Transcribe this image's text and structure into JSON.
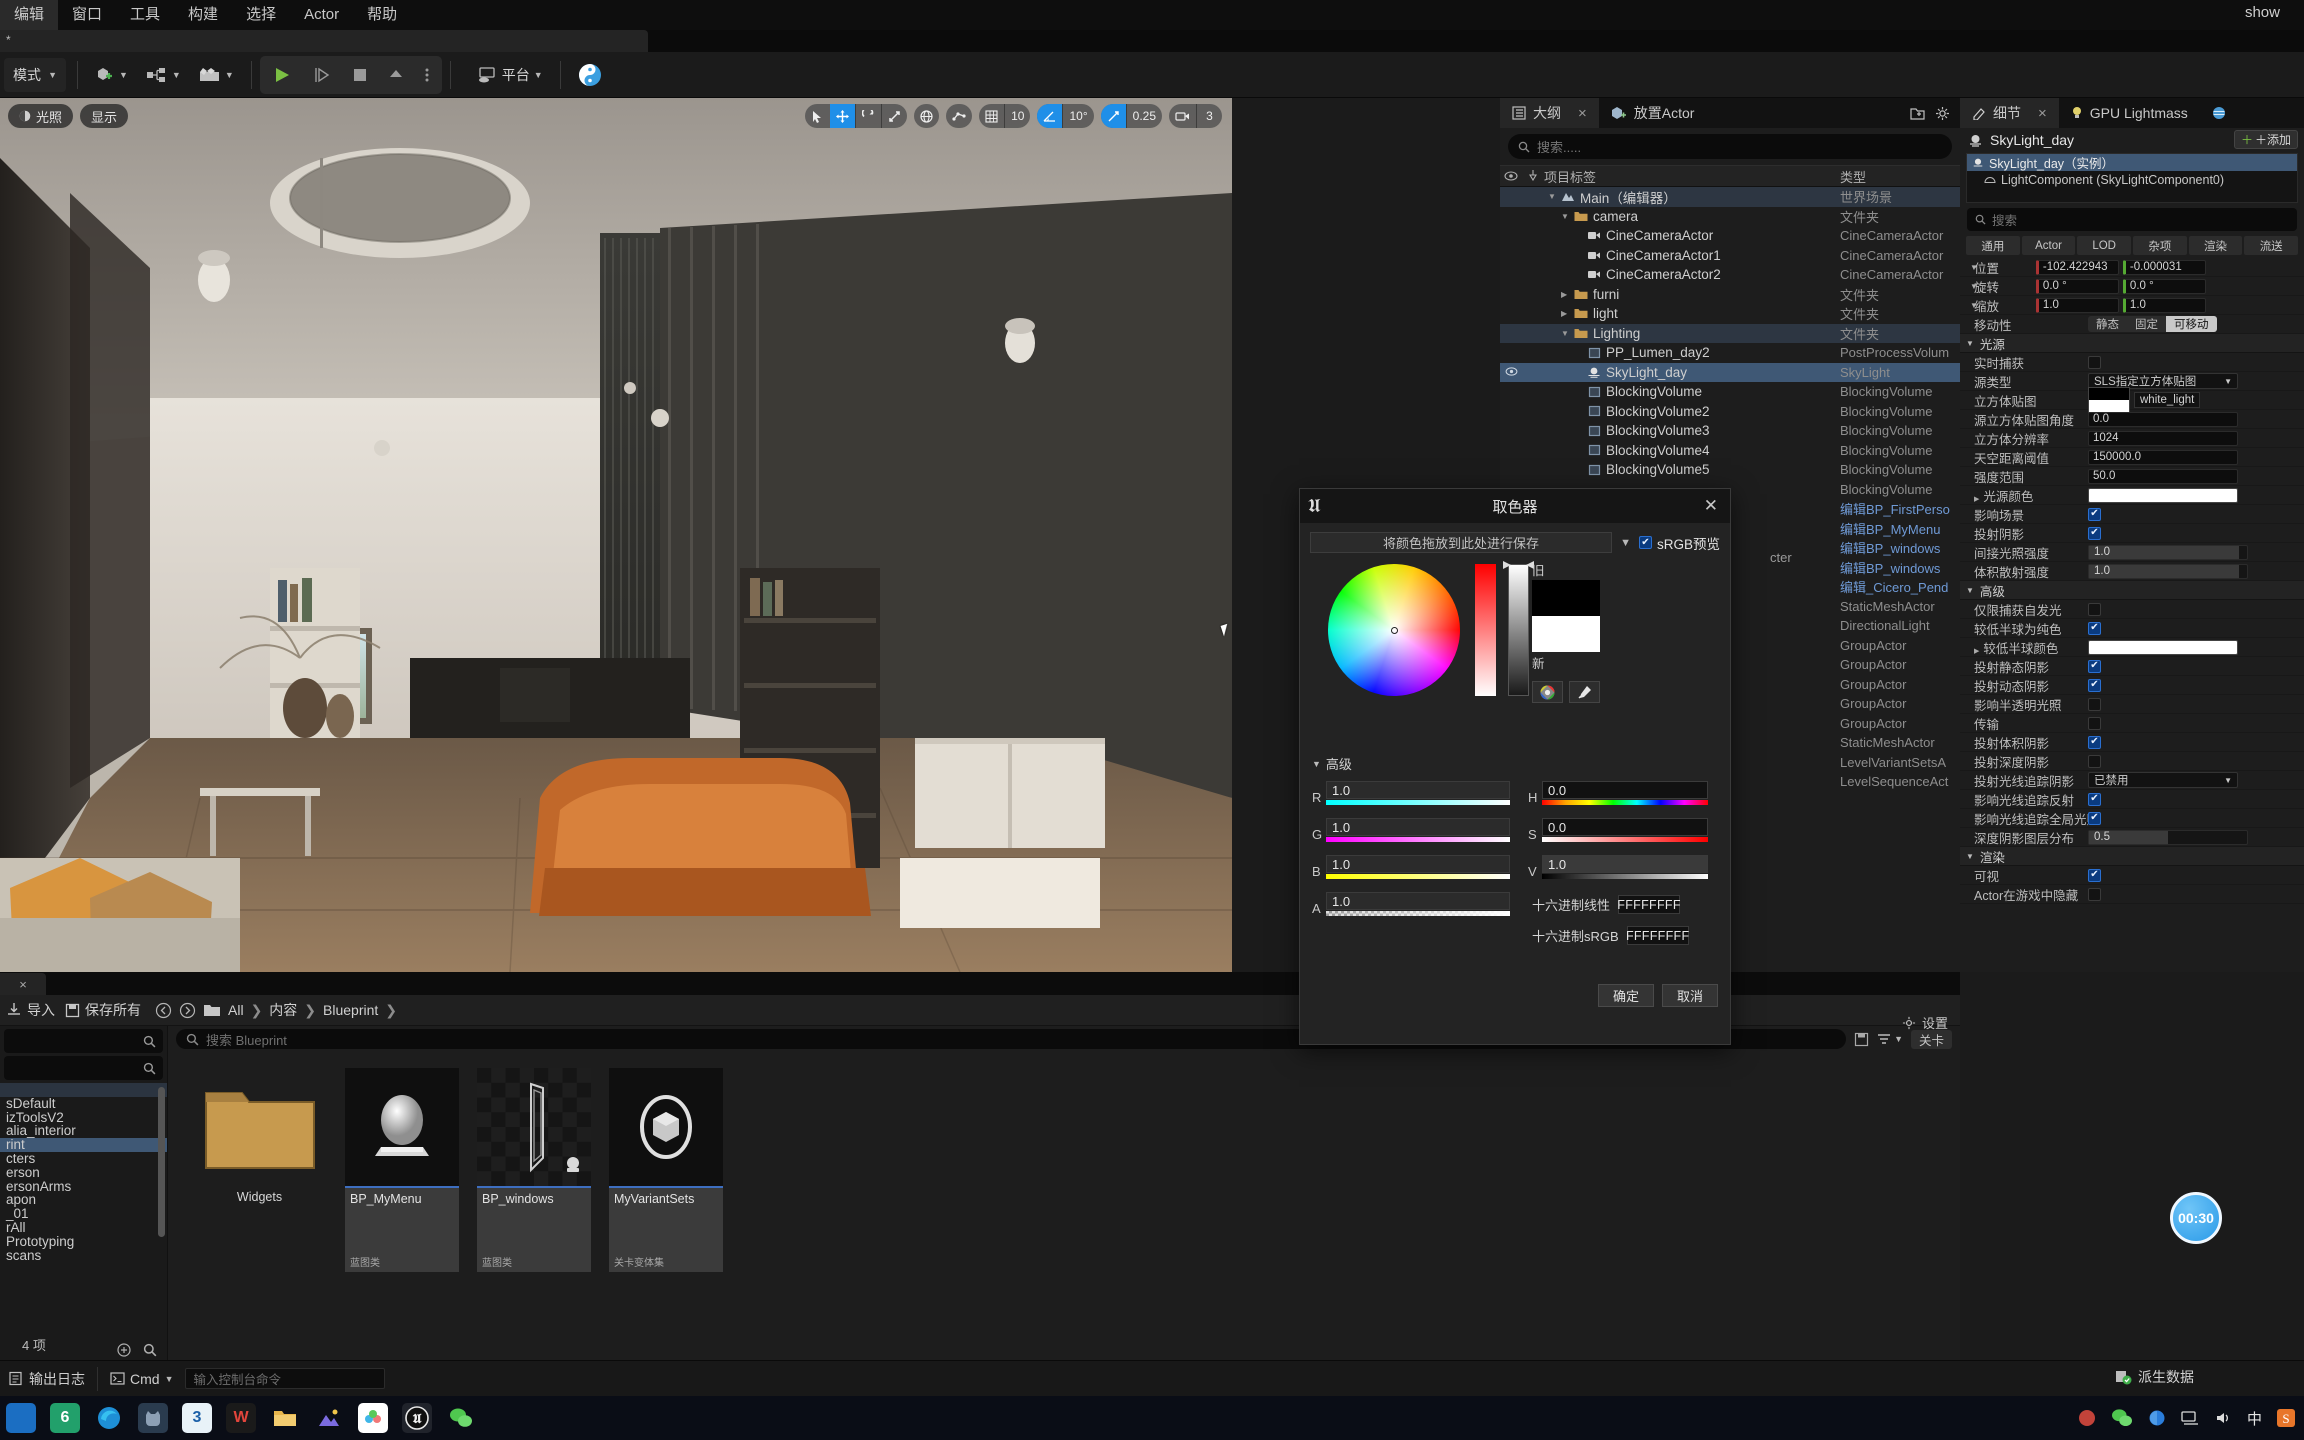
{
  "menubar": {
    "items": [
      "编辑",
      "窗口",
      "工具",
      "构建",
      "选择",
      "Actor",
      "帮助"
    ],
    "right_label": "show"
  },
  "tabstrip": {
    "star": "*"
  },
  "toolbar": {
    "mode_label": "模式",
    "add_label": "",
    "blueprint_label": "",
    "sequence_label": "",
    "platform_label": "平台"
  },
  "viewport": {
    "lighting_pill": "光照",
    "show_pill": "显示",
    "grid_value": "10",
    "angle_value": "10°",
    "scale_value": "0.25",
    "camera_value": "3"
  },
  "outliner": {
    "tab_label": "大纲",
    "tab2_label": "放置Actor",
    "search_placeholder": "搜索.....",
    "col_name": "项目标签",
    "col_type": "类型",
    "rows": [
      {
        "indent": 2,
        "label": "Main（编辑器）",
        "type": "世界场景",
        "state": "softsel",
        "expand": "down",
        "icon": "world-icon",
        "eye": false
      },
      {
        "indent": 3,
        "label": "camera",
        "type": "文件夹",
        "state": "",
        "expand": "down",
        "icon": "folder-icon",
        "eye": false
      },
      {
        "indent": 4,
        "label": "CineCameraActor",
        "type": "CineCameraActor",
        "state": "",
        "expand": "",
        "icon": "camera-icon",
        "eye": false
      },
      {
        "indent": 4,
        "label": "CineCameraActor1",
        "type": "CineCameraActor",
        "state": "",
        "expand": "",
        "icon": "camera-icon",
        "eye": false
      },
      {
        "indent": 4,
        "label": "CineCameraActor2",
        "type": "CineCameraActor",
        "state": "",
        "expand": "",
        "icon": "camera-icon",
        "eye": false
      },
      {
        "indent": 3,
        "label": "furni",
        "type": "文件夹",
        "state": "",
        "expand": "right",
        "icon": "folder-icon",
        "eye": false
      },
      {
        "indent": 3,
        "label": "light",
        "type": "文件夹",
        "state": "",
        "expand": "right",
        "icon": "folder-icon",
        "eye": false
      },
      {
        "indent": 3,
        "label": "Lighting",
        "type": "文件夹",
        "state": "softsel",
        "expand": "down",
        "icon": "folder-icon",
        "eye": false
      },
      {
        "indent": 4,
        "label": "PP_Lumen_day2",
        "type": "PostProcessVolum",
        "state": "",
        "expand": "",
        "icon": "volume-icon",
        "eye": false
      },
      {
        "indent": 4,
        "label": "SkyLight_day",
        "type": "SkyLight",
        "state": "sel",
        "expand": "",
        "icon": "skylight-icon",
        "eye": true
      },
      {
        "indent": 4,
        "label": "BlockingVolume",
        "type": "BlockingVolume",
        "state": "",
        "expand": "",
        "icon": "volume-icon",
        "eye": false
      },
      {
        "indent": 4,
        "label": "BlockingVolume2",
        "type": "BlockingVolume",
        "state": "",
        "expand": "",
        "icon": "volume-icon",
        "eye": false
      },
      {
        "indent": 4,
        "label": "BlockingVolume3",
        "type": "BlockingVolume",
        "state": "",
        "expand": "",
        "icon": "volume-icon",
        "eye": false
      },
      {
        "indent": 4,
        "label": "BlockingVolume4",
        "type": "BlockingVolume",
        "state": "",
        "expand": "",
        "icon": "volume-icon",
        "eye": false
      },
      {
        "indent": 4,
        "label": "BlockingVolume5",
        "type": "BlockingVolume",
        "state": "",
        "expand": "",
        "icon": "volume-icon",
        "eye": false
      },
      {
        "indent": 4,
        "label": "",
        "type": "BlockingVolume",
        "state": "",
        "expand": "",
        "icon": "",
        "eye": false
      },
      {
        "indent": 4,
        "label": "",
        "type": "编辑BP_FirstPerso",
        "type_blue": true,
        "state": "",
        "expand": "",
        "icon": "",
        "eye": false
      },
      {
        "indent": 4,
        "label": "",
        "type": "编辑BP_MyMenu",
        "type_blue": true,
        "state": "",
        "expand": "",
        "icon": "",
        "eye": false
      },
      {
        "indent": 4,
        "label": "",
        "type": "编辑BP_windows",
        "type_blue": true,
        "state": "",
        "expand": "",
        "icon": "",
        "eye": false
      },
      {
        "indent": 4,
        "label": "",
        "type": "编辑BP_windows",
        "type_blue": true,
        "state": "",
        "expand": "",
        "icon": "",
        "eye": false
      },
      {
        "indent": 4,
        "label": "",
        "type": "编辑_Cicero_Pend",
        "type_blue": true,
        "state": "",
        "expand": "",
        "icon": "",
        "eye": false
      },
      {
        "indent": 4,
        "label": "",
        "type": "StaticMeshActor",
        "state": "",
        "expand": "",
        "icon": "",
        "eye": false
      },
      {
        "indent": 4,
        "label": "",
        "type": "DirectionalLight",
        "state": "",
        "expand": "",
        "icon": "",
        "eye": false
      },
      {
        "indent": 4,
        "label": "",
        "type": "GroupActor",
        "state": "",
        "expand": "",
        "icon": "",
        "eye": false
      },
      {
        "indent": 4,
        "label": "",
        "type": "GroupActor",
        "state": "",
        "expand": "",
        "icon": "",
        "eye": false
      },
      {
        "indent": 4,
        "label": "",
        "type": "GroupActor",
        "state": "",
        "expand": "",
        "icon": "",
        "eye": false
      },
      {
        "indent": 4,
        "label": "",
        "type": "GroupActor",
        "state": "",
        "expand": "",
        "icon": "",
        "eye": false
      },
      {
        "indent": 4,
        "label": "",
        "type": "GroupActor",
        "state": "",
        "expand": "",
        "icon": "",
        "eye": false
      },
      {
        "indent": 4,
        "label": "",
        "type": "StaticMeshActor",
        "state": "",
        "expand": "",
        "icon": "",
        "eye": false
      },
      {
        "indent": 4,
        "label": "",
        "type": "LevelVariantSetsA",
        "state": "",
        "expand": "",
        "icon": "",
        "eye": false
      },
      {
        "indent": 4,
        "label": "",
        "type": "LevelSequenceAct",
        "state": "",
        "expand": "",
        "icon": "",
        "eye": false
      }
    ],
    "float_label": "cter"
  },
  "details": {
    "tab_label": "细节",
    "tab2_label": "GPU Lightmass",
    "actor_name": "SkyLight_day",
    "add_button": "＋添加",
    "tree": [
      {
        "label": "SkyLight_day（实例）",
        "selected": true,
        "icon": "skylight-icon"
      },
      {
        "label": "LightComponent (SkyLightComponent0)",
        "selected": false,
        "icon": "component-icon"
      }
    ],
    "search_placeholder": "搜索",
    "categories": [
      "通用",
      "Actor",
      "LOD",
      "杂项",
      "渲染",
      "流送"
    ],
    "transform": [
      {
        "label": "位置",
        "x": "-102.422943",
        "y": "-0.000031",
        "z": ""
      },
      {
        "label": "旋转",
        "x": "0.0 °",
        "y": "0.0 °",
        "z": ""
      },
      {
        "label": "缩放",
        "x": "1.0",
        "y": "1.0",
        "z": ""
      }
    ],
    "mobility_label": "移动性",
    "mobility_options": [
      "静态",
      "固定",
      "可移动"
    ],
    "mobility_selected": "可移动",
    "light_section": "光源",
    "props": [
      {
        "label": "实时捕获",
        "kind": "checkbox",
        "value": false
      },
      {
        "label": "源类型",
        "kind": "dropdown",
        "value": "SLS指定立方体贴图"
      },
      {
        "label": "立方体贴图",
        "kind": "asset",
        "value": "white_light"
      },
      {
        "label": "源立方体贴图角度",
        "kind": "text",
        "value": "0.0"
      },
      {
        "label": "立方体分辨率",
        "kind": "text",
        "value": "1024"
      },
      {
        "label": "天空距离阈值",
        "kind": "text",
        "value": "150000.0"
      },
      {
        "label": "强度范围",
        "kind": "text",
        "value": "50.0"
      },
      {
        "label": "光源颜色",
        "kind": "color",
        "value": "#ffffff",
        "expandable": true
      },
      {
        "label": "影响场景",
        "kind": "checkbox",
        "value": true
      },
      {
        "label": "投射阴影",
        "kind": "checkbox",
        "value": true
      },
      {
        "label": "间接光照强度",
        "kind": "slider",
        "value": "1.0"
      },
      {
        "label": "体积散射强度",
        "kind": "slider",
        "value": "1.0"
      }
    ],
    "advanced_section": "高级",
    "advanced_props": [
      {
        "label": "仅限捕获自发光",
        "kind": "checkbox",
        "value": false
      },
      {
        "label": "较低半球为纯色",
        "kind": "checkbox",
        "value": true
      },
      {
        "label": "较低半球颜色",
        "kind": "color",
        "value": "#ffffff",
        "expandable": true
      },
      {
        "label": "投射静态阴影",
        "kind": "checkbox",
        "value": true
      },
      {
        "label": "投射动态阴影",
        "kind": "checkbox",
        "value": true
      },
      {
        "label": "影响半透明光照",
        "kind": "checkbox",
        "value": false
      },
      {
        "label": "传输",
        "kind": "checkbox",
        "value": false
      },
      {
        "label": "投射体积阴影",
        "kind": "checkbox",
        "value": true
      },
      {
        "label": "投射深度阴影",
        "kind": "checkbox",
        "value": false
      },
      {
        "label": "投射光线追踪阴影",
        "kind": "dropdown",
        "value": "已禁用"
      },
      {
        "label": "影响光线追踪反射",
        "kind": "checkbox",
        "value": true
      },
      {
        "label": "影响光线追踪全局光照",
        "kind": "checkbox",
        "value": true
      },
      {
        "label": "深度阴影图层分布",
        "kind": "slider",
        "value": "0.5"
      }
    ],
    "render_section": "渲染",
    "render_props": [
      {
        "label": "可视",
        "kind": "checkbox",
        "value": true
      },
      {
        "label": "Actor在游戏中隐藏",
        "kind": "checkbox",
        "value": false
      }
    ]
  },
  "content_browser": {
    "tab_close": "×",
    "import_label": "导入",
    "save_all_label": "保存所有",
    "breadcrumb": [
      "All",
      "内容",
      "Blueprint"
    ],
    "search_placeholder": "搜索 Blueprint",
    "filter_label": "关卡",
    "settings_label": "设置",
    "tree_items": [
      {
        "label": "",
        "state": "hl"
      },
      {
        "label": "sDefault",
        "state": ""
      },
      {
        "label": "izToolsV2",
        "state": ""
      },
      {
        "label": "alia_interior",
        "state": ""
      },
      {
        "label": "rint",
        "state": "sel"
      },
      {
        "label": "cters",
        "state": ""
      },
      {
        "label": "erson",
        "state": ""
      },
      {
        "label": "ersonArms",
        "state": ""
      },
      {
        "label": "apon",
        "state": ""
      },
      {
        "label": "_01",
        "state": ""
      },
      {
        "label": "rAll",
        "state": ""
      },
      {
        "label": "Prototyping",
        "state": ""
      },
      {
        "label": "scans",
        "state": ""
      }
    ],
    "tiles": [
      {
        "name": "Widgets",
        "type": "",
        "kind": "folder"
      },
      {
        "name": "BP_MyMenu",
        "type": "蓝图类",
        "kind": "blueprint-sphere"
      },
      {
        "name": "BP_windows",
        "type": "蓝图类",
        "kind": "blueprint-window"
      },
      {
        "name": "MyVariantSets",
        "type": "关卡变体集",
        "kind": "variant-set"
      }
    ],
    "item_count": "4 项"
  },
  "color_picker": {
    "title": "取色器",
    "save_hint": "将颜色拖放到此处进行保存",
    "srgb_label": "sRGB预览",
    "srgb_checked": true,
    "old_label": "旧",
    "new_label": "新",
    "old_color": "#000000",
    "new_color": "#ffffff",
    "advanced_label": "高级",
    "channels": [
      {
        "key": "R",
        "value": "1.0"
      },
      {
        "key": "G",
        "value": "1.0"
      },
      {
        "key": "B",
        "value": "1.0"
      },
      {
        "key": "A",
        "value": "1.0"
      }
    ],
    "hsv": [
      {
        "key": "H",
        "value": "0.0"
      },
      {
        "key": "S",
        "value": "0.0"
      },
      {
        "key": "V",
        "value": "1.0"
      }
    ],
    "hex_linear_label": "十六进制线性",
    "hex_linear_value": "FFFFFFFF",
    "hex_srgb_label": "十六进制sRGB",
    "hex_srgb_value": "FFFFFFFF",
    "ok_label": "确定",
    "cancel_label": "取消"
  },
  "statusbar": {
    "output_log": "输出日志",
    "cmd_label": "Cmd",
    "cmd_placeholder": "输入控制台命令",
    "derived_data": "派生数据"
  },
  "taskbar": {
    "ime": "中",
    "timer_badge": "00:30"
  },
  "colors": {
    "accent_blue": "#1f8fe8",
    "selection_blue": "#3f5875",
    "folder_gold": "#c79a4e",
    "panel_bg": "#1d1d1d",
    "dark_bg": "#0e0e0e"
  }
}
